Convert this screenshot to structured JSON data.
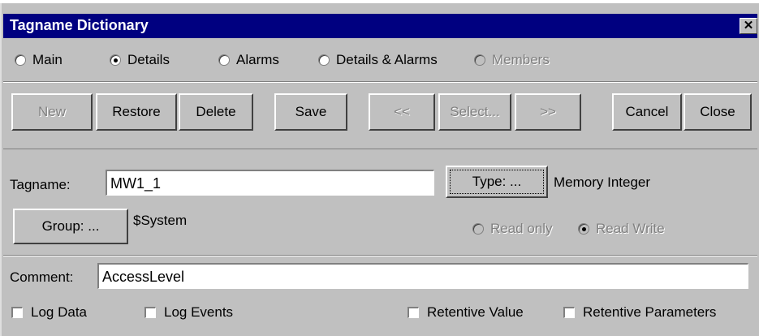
{
  "window": {
    "title": "Tagname Dictionary",
    "close_glyph": "✕"
  },
  "view_options": [
    {
      "label": "Main",
      "selected": false,
      "enabled": true
    },
    {
      "label": "Details",
      "selected": true,
      "enabled": true
    },
    {
      "label": "Alarms",
      "selected": false,
      "enabled": true
    },
    {
      "label": "Details & Alarms",
      "selected": false,
      "enabled": true
    },
    {
      "label": "Members",
      "selected": false,
      "enabled": false
    }
  ],
  "toolbar": {
    "new": "New",
    "restore": "Restore",
    "delete": "Delete",
    "save": "Save",
    "prev": "<<",
    "select": "Select...",
    "next": ">>",
    "cancel": "Cancel",
    "close": "Close"
  },
  "form": {
    "tagname_label": "Tagname:",
    "tagname_value": "MW1_1",
    "type_button": "Type: ...",
    "type_value": "Memory Integer",
    "group_button": "Group: ...",
    "group_value": "$System",
    "read_only": "Read only",
    "read_write": "Read Write",
    "comment_label": "Comment:",
    "comment_value": "AccessLevel"
  },
  "checkboxes": {
    "log_data": "Log Data",
    "log_events": "Log Events",
    "retentive_value": "Retentive Value",
    "retentive_parameters": "Retentive Parameters"
  }
}
